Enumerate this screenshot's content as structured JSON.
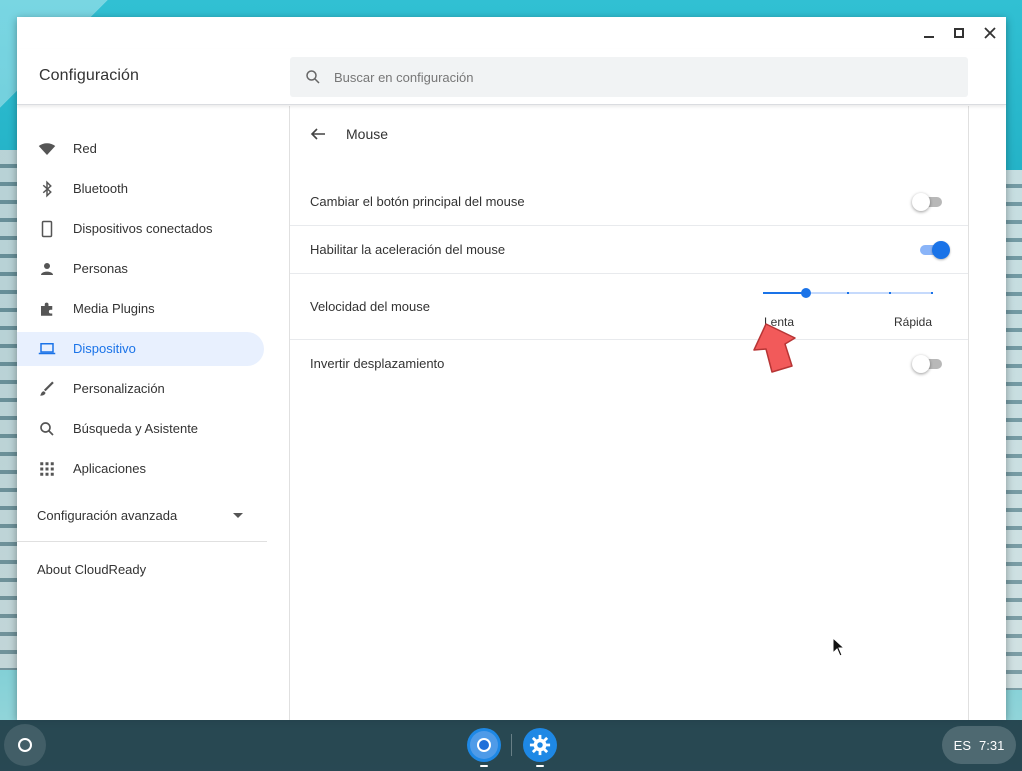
{
  "app": {
    "title": "Configuración",
    "search_placeholder": "Buscar en configuración"
  },
  "sidebar": {
    "items": [
      {
        "label": "Red",
        "icon": "wifi-icon",
        "active": false
      },
      {
        "label": "Bluetooth",
        "icon": "bluetooth-icon",
        "active": false
      },
      {
        "label": "Dispositivos conectados",
        "icon": "phone-icon",
        "active": false
      },
      {
        "label": "Personas",
        "icon": "person-icon",
        "active": false
      },
      {
        "label": "Media Plugins",
        "icon": "puzzle-icon",
        "active": false
      },
      {
        "label": "Dispositivo",
        "icon": "laptop-icon",
        "active": true
      },
      {
        "label": "Personalización",
        "icon": "brush-icon",
        "active": false
      },
      {
        "label": "Búsqueda y Asistente",
        "icon": "search-icon",
        "active": false
      },
      {
        "label": "Aplicaciones",
        "icon": "apps-grid-icon",
        "active": false
      }
    ],
    "advanced_label": "Configuración avanzada",
    "about_label": "About CloudReady"
  },
  "subpage": {
    "title": "Mouse",
    "settings": {
      "swap_primary": {
        "label": "Cambiar el botón principal del mouse",
        "enabled": false
      },
      "acceleration": {
        "label": "Habilitar la aceleración del mouse",
        "enabled": true
      },
      "speed": {
        "label": "Velocidad del mouse",
        "min_label": "Lenta",
        "max_label": "Rápida",
        "value": 2,
        "min": 1,
        "max": 5
      },
      "reverse_scroll": {
        "label": "Invertir desplazamiento",
        "enabled": false
      }
    }
  },
  "shelf": {
    "language": "ES",
    "time": "7:31"
  },
  "colors": {
    "accent": "#1a73e8",
    "active_nav_bg": "#e8f0fe",
    "annotation_arrow": "#f25a5a"
  }
}
